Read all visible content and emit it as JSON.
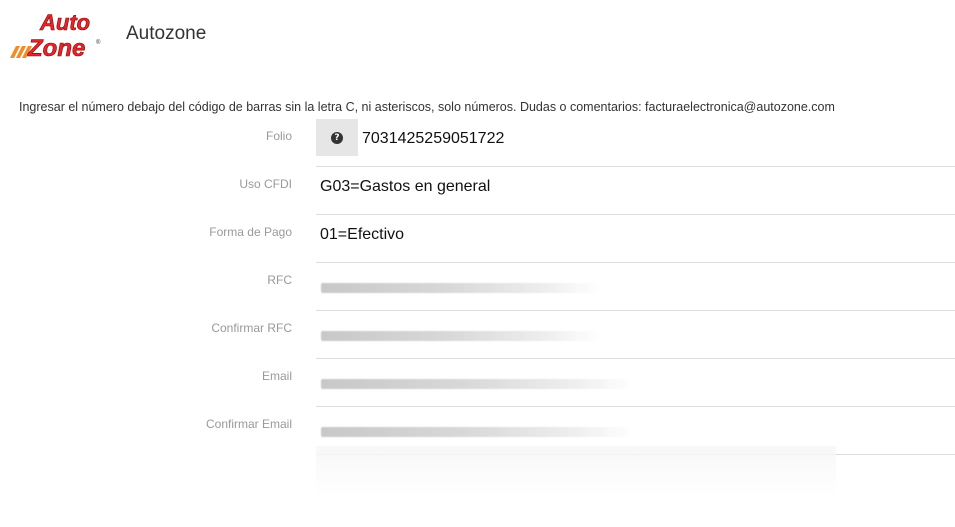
{
  "header": {
    "logo_text": "AutoZone",
    "title": "Autozone"
  },
  "instructions": "Ingresar el número debajo del código de barras sin la letra C, ni asteriscos, solo números. Dudas o comentarios: facturaelectronica@autozone.com",
  "form": {
    "folio": {
      "label": "Folio",
      "value": "7031425259051722",
      "addon_icon": "question-circle-icon"
    },
    "uso_cfdi": {
      "label": "Uso CFDI",
      "value": "G03=Gastos en general"
    },
    "forma_pago": {
      "label": "Forma de Pago",
      "value": "01=Efectivo"
    },
    "rfc": {
      "label": "RFC",
      "value": ""
    },
    "confirmar_rfc": {
      "label": "Confirmar RFC",
      "value": ""
    },
    "email": {
      "label": "Email",
      "value": ""
    },
    "confirmar_email": {
      "label": "Confirmar Email",
      "value": ""
    }
  },
  "colors": {
    "logo_red": "#e3262b",
    "logo_orange": "#f28c28",
    "label_gray": "#999999",
    "addon_bg": "#e6e6e6",
    "divider": "#dddddd"
  }
}
